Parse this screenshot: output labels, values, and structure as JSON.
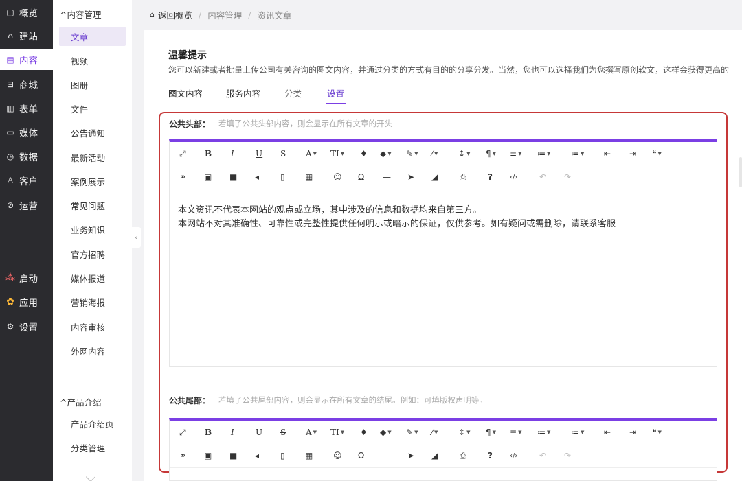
{
  "nav": {
    "items": [
      {
        "label": "概览",
        "icon": "▢"
      },
      {
        "label": "建站",
        "icon": "⌂"
      },
      {
        "label": "内容",
        "icon": "▤"
      },
      {
        "label": "商城",
        "icon": "⊟"
      },
      {
        "label": "表单",
        "icon": "▥"
      },
      {
        "label": "媒体",
        "icon": "▭"
      },
      {
        "label": "数据",
        "icon": "◷"
      },
      {
        "label": "客户",
        "icon": "♙"
      },
      {
        "label": "运营",
        "icon": "⊘"
      },
      {
        "label": "启动",
        "icon": "⁂"
      },
      {
        "label": "应用",
        "icon": "✿"
      },
      {
        "label": "设置",
        "icon": "⚙"
      }
    ]
  },
  "submenu": {
    "content_group": "内容管理",
    "items": [
      "文章",
      "视频",
      "图册",
      "文件",
      "公告通知",
      "最新活动",
      "案例展示",
      "常见问题",
      "业务知识",
      "官方招聘",
      "媒体报道",
      "营销海报",
      "内容审核",
      "外网内容"
    ],
    "product_group": "产品介绍",
    "product_items": [
      "产品介绍页",
      "分类管理"
    ]
  },
  "breadcrumb": {
    "home": "返回概览",
    "items": [
      "内容管理",
      "资讯文章"
    ],
    "sep": "/"
  },
  "tip": {
    "title": "温馨提示",
    "text": "您可以新建或者批量上传公司有关咨询的图文内容，并通过分类的方式有目的的分享分发。当然，您也可以选择我们为您撰写原创软文，这样会获得更高的"
  },
  "tabs": [
    "图文内容",
    "服务内容",
    "分类",
    "设置"
  ],
  "header_field": {
    "label": "公共头部：",
    "hint": "若填了公共头部内容，则会显示在所有文章的开头",
    "content_line1": "本文资讯不代表本网站的观点或立场，其中涉及的信息和数据均来自第三方。",
    "content_line2": "本网站不对其准确性、可靠性或完整性提供任何明示或暗示的保证，仅供参考。如有疑问或需删除，请联系客服"
  },
  "footer_field": {
    "label": "公共尾部：",
    "hint": "若填了公共尾部内容，则会显示在所有文章的结尾。例如：可填版权声明等。"
  },
  "toolbar": {
    "row1": [
      "⤢",
      "B",
      "I",
      "U",
      "S",
      "A",
      "TI",
      "♦",
      "◆",
      "✎",
      "⁄",
      "↕",
      "¶",
      "≡",
      "≔",
      "≔",
      "⇤",
      "⇥",
      "❝"
    ],
    "row2": [
      "⚭",
      "▣",
      "■",
      "◂",
      "▯",
      "▦",
      "☺",
      "Ω",
      "—",
      "➤",
      "◢",
      "⎙",
      "?",
      "‹/›",
      "↶",
      "↷"
    ]
  },
  "colors": {
    "accent": "#7b3fe4",
    "nav_bg": "#2b2b2f",
    "highlight_border": "#c63838"
  }
}
